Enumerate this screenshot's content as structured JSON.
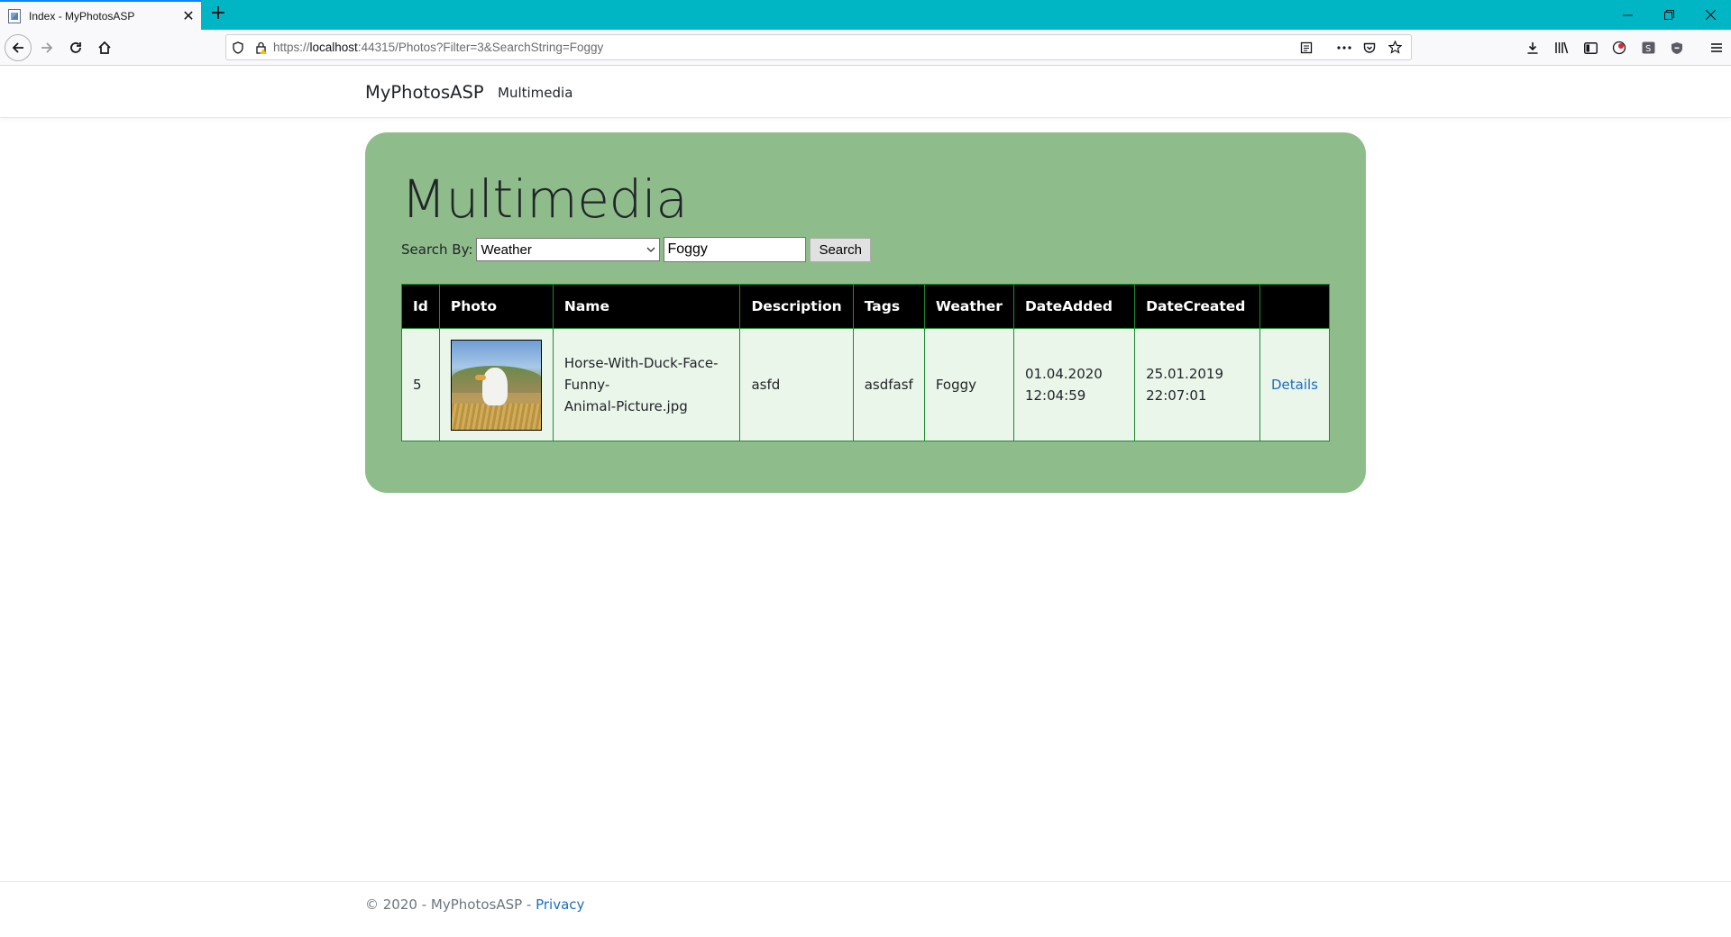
{
  "browser": {
    "tab_title": "Index - MyPhotosASP",
    "tab_close": "✕",
    "new_tab": "+",
    "url_prefix": "https://",
    "url_host": "localhost",
    "url_rest": ":44315/Photos?Filter=3&SearchString=Foggy",
    "icons": [
      "back-icon",
      "forward-icon",
      "reload-icon",
      "home-icon",
      "shield-icon",
      "lock-warning-icon",
      "reader-view-icon",
      "more-icon",
      "pocket-icon",
      "bookmark-star-icon",
      "download-icon",
      "library-icon",
      "sidebar-icon",
      "extension-icon",
      "screenshot-icon",
      "shield-extension-icon",
      "menu-icon"
    ]
  },
  "site": {
    "brand": "MyPhotosASP",
    "nav_multimedia": "Multimedia"
  },
  "main": {
    "title": "Multimedia",
    "search_label": "Search By:",
    "search_by_value": "Weather",
    "search_string": "Foggy",
    "search_button": "Search",
    "table": {
      "headers": [
        "Id",
        "Photo",
        "Name",
        "Description",
        "Tags",
        "Weather",
        "DateAdded",
        "DateCreated",
        ""
      ],
      "rows": [
        {
          "id": "5",
          "name_line1": "Horse-With-Duck-Face-Funny-",
          "name_line2": "Animal-Picture.jpg",
          "description": "asfd",
          "tags": "asdfasf",
          "weather": "Foggy",
          "date_added_line1": "01.04.2020",
          "date_added_line2": "12:04:59",
          "date_created_line1": "25.01.2019",
          "date_created_line2": "22:07:01",
          "details": "Details"
        }
      ]
    }
  },
  "footer": {
    "text": "© 2020 - MyPhotosASP - ",
    "privacy": "Privacy"
  },
  "colors": {
    "panel": "#8fbc8b",
    "row_bg": "#ebf6eb",
    "table_border": "#1d8a2f",
    "link": "#1b6ec2",
    "tabbar": "#00b5c4"
  }
}
